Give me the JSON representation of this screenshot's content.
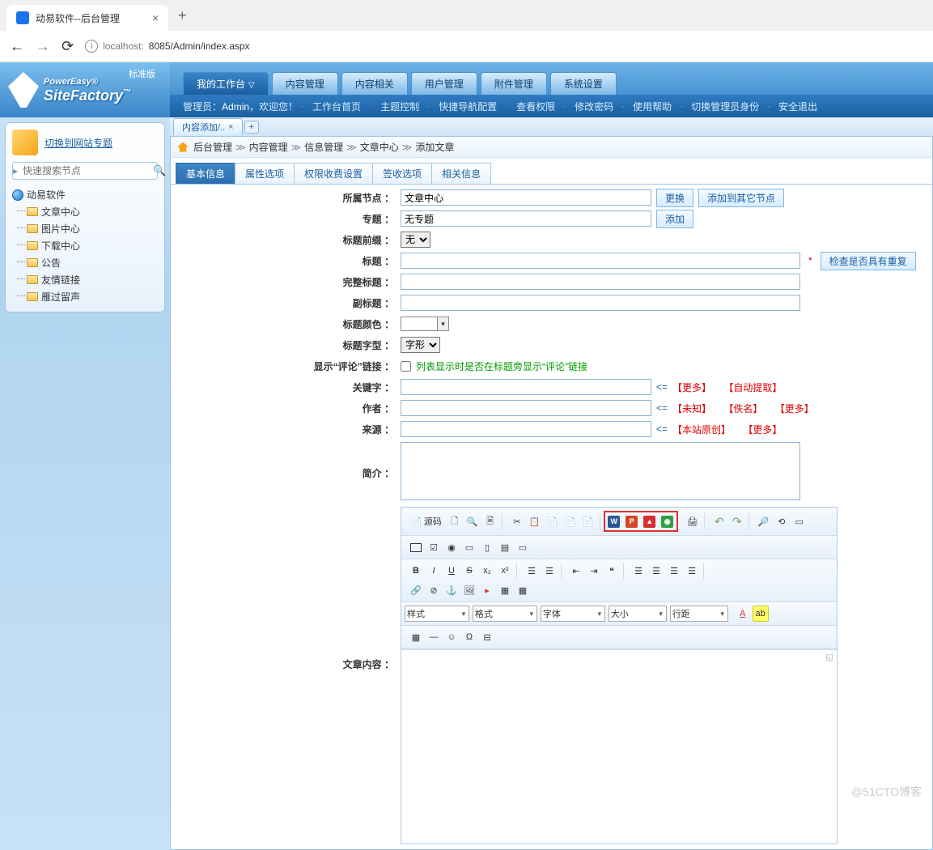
{
  "browser": {
    "tab_title": "动易软件--后台管理",
    "url_info_label": "i",
    "url_host": "localhost:",
    "url_path": "8085/Admin/index.aspx"
  },
  "logo": {
    "power": "PowerEasy®",
    "name": "SiteFactory",
    "tm": "™",
    "version": "标准版"
  },
  "nav": {
    "items": [
      "我的工作台",
      "内容管理",
      "内容相关",
      "用户管理",
      "附件管理",
      "系统设置"
    ],
    "admin_prefix": "管理员：",
    "admin_name": "Admin",
    "welcome": "，欢迎您！",
    "sub": [
      "工作台首页",
      "主题控制",
      "快捷导航配置",
      "查看权限",
      "修改密码",
      "使用帮助",
      "切换管理员身份",
      "安全退出"
    ]
  },
  "sidebar": {
    "switch_link": "切换到网站专题",
    "search_placeholder": "快速搜索节点",
    "root": "动易软件",
    "items": [
      "文章中心",
      "图片中心",
      "下载中心",
      "公告",
      "友情链接",
      "雁过留声"
    ]
  },
  "page_tab": {
    "title": "内容添加/..",
    "add": "+"
  },
  "breadcrumb": [
    "后台管理",
    "内容管理",
    "信息管理",
    "文章中心",
    "添加文章"
  ],
  "form_tabs": [
    "基本信息",
    "属性选项",
    "权限收费设置",
    "签收选项",
    "相关信息"
  ],
  "form": {
    "labels": {
      "node": "所属节点 ：",
      "topic": "专题 ：",
      "prefix": "标题前缀 ：",
      "title": "标题 ：",
      "fulltitle": "完整标题 ：",
      "subtitle": "副标题 ：",
      "titlecolor": "标题颜色 ：",
      "titlefont": "标题字型 ：",
      "showcomment": "显示“评论”链接 ：",
      "keywords": "关键字 ：",
      "author": "作者 ：",
      "source": "来源 ：",
      "intro": "简介 ：",
      "content": "文章内容 ："
    },
    "node_value": "文章中心",
    "topic_value": "无专题",
    "prefix_value": "无",
    "btn_change": "更换",
    "btn_addother": "添加到其它节点",
    "btn_add": "添加",
    "btn_check": "检查是否具有重复",
    "font_value": "字形",
    "comment_hint": "列表显示时是否在标题旁显示“评论”链接",
    "kw_more": "【更多】",
    "kw_auto": "【自动提取】",
    "kw_arrow": "<=",
    "author_un": "【未知】",
    "author_anon": "【佚名】",
    "author_more": "【更多】",
    "src_orig": "【本站原创】",
    "src_more": "【更多】"
  },
  "editor": {
    "source": "源码",
    "style": "样式",
    "format": "格式",
    "font": "字体",
    "size": "大小",
    "linesp": "行距"
  },
  "watermark": "@51CTO博客"
}
